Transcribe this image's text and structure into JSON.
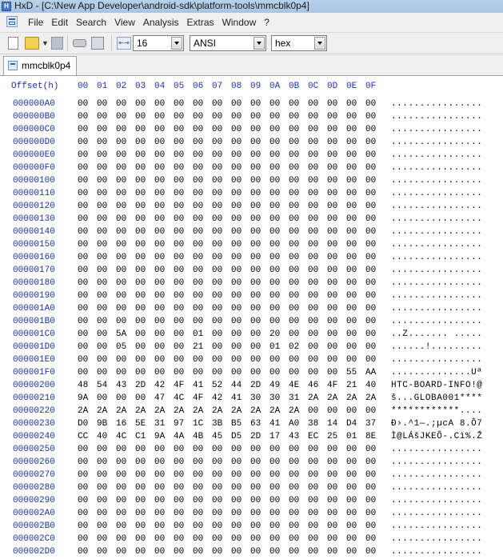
{
  "window": {
    "title": "HxD - [C:\\New App Developer\\android-sdk\\platform-tools\\mmcblk0p4]"
  },
  "menu": [
    "File",
    "Edit",
    "Search",
    "View",
    "Analysis",
    "Extras",
    "Window",
    "?"
  ],
  "toolbar": {
    "bytes_per_row": "16",
    "charset": "ANSI",
    "offset_base": "hex",
    "icons": [
      "new-file-icon",
      "open-file-icon",
      "save-icon",
      "open-disk-icon",
      "open-ram-icon",
      "bytes-per-row-icon"
    ]
  },
  "tabs": [
    {
      "label": "mmcblk0p4"
    }
  ],
  "hex": {
    "offset_header": "Offset(h)",
    "columns": [
      "00",
      "01",
      "02",
      "03",
      "04",
      "05",
      "06",
      "07",
      "08",
      "09",
      "0A",
      "0B",
      "0C",
      "0D",
      "0E",
      "0F"
    ],
    "rows": [
      {
        "offset": "000000A0",
        "bytes": [
          "00",
          "00",
          "00",
          "00",
          "00",
          "00",
          "00",
          "00",
          "00",
          "00",
          "00",
          "00",
          "00",
          "00",
          "00",
          "00"
        ],
        "ascii": "................"
      },
      {
        "offset": "000000B0",
        "bytes": [
          "00",
          "00",
          "00",
          "00",
          "00",
          "00",
          "00",
          "00",
          "00",
          "00",
          "00",
          "00",
          "00",
          "00",
          "00",
          "00"
        ],
        "ascii": "................"
      },
      {
        "offset": "000000C0",
        "bytes": [
          "00",
          "00",
          "00",
          "00",
          "00",
          "00",
          "00",
          "00",
          "00",
          "00",
          "00",
          "00",
          "00",
          "00",
          "00",
          "00"
        ],
        "ascii": "................"
      },
      {
        "offset": "000000D0",
        "bytes": [
          "00",
          "00",
          "00",
          "00",
          "00",
          "00",
          "00",
          "00",
          "00",
          "00",
          "00",
          "00",
          "00",
          "00",
          "00",
          "00"
        ],
        "ascii": "................"
      },
      {
        "offset": "000000E0",
        "bytes": [
          "00",
          "00",
          "00",
          "00",
          "00",
          "00",
          "00",
          "00",
          "00",
          "00",
          "00",
          "00",
          "00",
          "00",
          "00",
          "00"
        ],
        "ascii": "................"
      },
      {
        "offset": "000000F0",
        "bytes": [
          "00",
          "00",
          "00",
          "00",
          "00",
          "00",
          "00",
          "00",
          "00",
          "00",
          "00",
          "00",
          "00",
          "00",
          "00",
          "00"
        ],
        "ascii": "................"
      },
      {
        "offset": "00000100",
        "bytes": [
          "00",
          "00",
          "00",
          "00",
          "00",
          "00",
          "00",
          "00",
          "00",
          "00",
          "00",
          "00",
          "00",
          "00",
          "00",
          "00"
        ],
        "ascii": "................"
      },
      {
        "offset": "00000110",
        "bytes": [
          "00",
          "00",
          "00",
          "00",
          "00",
          "00",
          "00",
          "00",
          "00",
          "00",
          "00",
          "00",
          "00",
          "00",
          "00",
          "00"
        ],
        "ascii": "................"
      },
      {
        "offset": "00000120",
        "bytes": [
          "00",
          "00",
          "00",
          "00",
          "00",
          "00",
          "00",
          "00",
          "00",
          "00",
          "00",
          "00",
          "00",
          "00",
          "00",
          "00"
        ],
        "ascii": "................"
      },
      {
        "offset": "00000130",
        "bytes": [
          "00",
          "00",
          "00",
          "00",
          "00",
          "00",
          "00",
          "00",
          "00",
          "00",
          "00",
          "00",
          "00",
          "00",
          "00",
          "00"
        ],
        "ascii": "................"
      },
      {
        "offset": "00000140",
        "bytes": [
          "00",
          "00",
          "00",
          "00",
          "00",
          "00",
          "00",
          "00",
          "00",
          "00",
          "00",
          "00",
          "00",
          "00",
          "00",
          "00"
        ],
        "ascii": "................"
      },
      {
        "offset": "00000150",
        "bytes": [
          "00",
          "00",
          "00",
          "00",
          "00",
          "00",
          "00",
          "00",
          "00",
          "00",
          "00",
          "00",
          "00",
          "00",
          "00",
          "00"
        ],
        "ascii": "................"
      },
      {
        "offset": "00000160",
        "bytes": [
          "00",
          "00",
          "00",
          "00",
          "00",
          "00",
          "00",
          "00",
          "00",
          "00",
          "00",
          "00",
          "00",
          "00",
          "00",
          "00"
        ],
        "ascii": "................"
      },
      {
        "offset": "00000170",
        "bytes": [
          "00",
          "00",
          "00",
          "00",
          "00",
          "00",
          "00",
          "00",
          "00",
          "00",
          "00",
          "00",
          "00",
          "00",
          "00",
          "00"
        ],
        "ascii": "................"
      },
      {
        "offset": "00000180",
        "bytes": [
          "00",
          "00",
          "00",
          "00",
          "00",
          "00",
          "00",
          "00",
          "00",
          "00",
          "00",
          "00",
          "00",
          "00",
          "00",
          "00"
        ],
        "ascii": "................"
      },
      {
        "offset": "00000190",
        "bytes": [
          "00",
          "00",
          "00",
          "00",
          "00",
          "00",
          "00",
          "00",
          "00",
          "00",
          "00",
          "00",
          "00",
          "00",
          "00",
          "00"
        ],
        "ascii": "................"
      },
      {
        "offset": "000001A0",
        "bytes": [
          "00",
          "00",
          "00",
          "00",
          "00",
          "00",
          "00",
          "00",
          "00",
          "00",
          "00",
          "00",
          "00",
          "00",
          "00",
          "00"
        ],
        "ascii": "................"
      },
      {
        "offset": "000001B0",
        "bytes": [
          "00",
          "00",
          "00",
          "00",
          "00",
          "00",
          "00",
          "00",
          "00",
          "00",
          "00",
          "00",
          "00",
          "00",
          "00",
          "00"
        ],
        "ascii": "................"
      },
      {
        "offset": "000001C0",
        "bytes": [
          "00",
          "00",
          "5A",
          "00",
          "00",
          "00",
          "01",
          "00",
          "00",
          "00",
          "20",
          "00",
          "00",
          "00",
          "00",
          "00"
        ],
        "ascii": "..Z....... ....."
      },
      {
        "offset": "000001D0",
        "bytes": [
          "00",
          "00",
          "05",
          "00",
          "00",
          "00",
          "21",
          "00",
          "00",
          "00",
          "01",
          "02",
          "00",
          "00",
          "00",
          "00"
        ],
        "ascii": "......!........."
      },
      {
        "offset": "000001E0",
        "bytes": [
          "00",
          "00",
          "00",
          "00",
          "00",
          "00",
          "00",
          "00",
          "00",
          "00",
          "00",
          "00",
          "00",
          "00",
          "00",
          "00"
        ],
        "ascii": "................"
      },
      {
        "offset": "000001F0",
        "bytes": [
          "00",
          "00",
          "00",
          "00",
          "00",
          "00",
          "00",
          "00",
          "00",
          "00",
          "00",
          "00",
          "00",
          "00",
          "55",
          "AA"
        ],
        "ascii": "..............Uª"
      },
      {
        "offset": "00000200",
        "bytes": [
          "48",
          "54",
          "43",
          "2D",
          "42",
          "4F",
          "41",
          "52",
          "44",
          "2D",
          "49",
          "4E",
          "46",
          "4F",
          "21",
          "40"
        ],
        "ascii": "HTC-BOARD-INFO!@"
      },
      {
        "offset": "00000210",
        "bytes": [
          "9A",
          "00",
          "00",
          "00",
          "47",
          "4C",
          "4F",
          "42",
          "41",
          "30",
          "30",
          "31",
          "2A",
          "2A",
          "2A",
          "2A"
        ],
        "ascii": "š...GLOBA001****"
      },
      {
        "offset": "00000220",
        "bytes": [
          "2A",
          "2A",
          "2A",
          "2A",
          "2A",
          "2A",
          "2A",
          "2A",
          "2A",
          "2A",
          "2A",
          "2A",
          "00",
          "00",
          "00",
          "00"
        ],
        "ascii": "************...."
      },
      {
        "offset": "00000230",
        "bytes": [
          "D0",
          "9B",
          "16",
          "5E",
          "31",
          "97",
          "1C",
          "3B",
          "B5",
          "63",
          "41",
          "A0",
          "38",
          "14",
          "D4",
          "37"
        ],
        "ascii": "Ð›.^1—.;µcA 8.Ô7"
      },
      {
        "offset": "00000240",
        "bytes": [
          "CC",
          "40",
          "4C",
          "C1",
          "9A",
          "4A",
          "4B",
          "45",
          "D5",
          "2D",
          "17",
          "43",
          "EC",
          "25",
          "01",
          "8E"
        ],
        "ascii": "Ì@LÁšJKEÕ-.Cì%.Ž"
      },
      {
        "offset": "00000250",
        "bytes": [
          "00",
          "00",
          "00",
          "00",
          "00",
          "00",
          "00",
          "00",
          "00",
          "00",
          "00",
          "00",
          "00",
          "00",
          "00",
          "00"
        ],
        "ascii": "................"
      },
      {
        "offset": "00000260",
        "bytes": [
          "00",
          "00",
          "00",
          "00",
          "00",
          "00",
          "00",
          "00",
          "00",
          "00",
          "00",
          "00",
          "00",
          "00",
          "00",
          "00"
        ],
        "ascii": "................"
      },
      {
        "offset": "00000270",
        "bytes": [
          "00",
          "00",
          "00",
          "00",
          "00",
          "00",
          "00",
          "00",
          "00",
          "00",
          "00",
          "00",
          "00",
          "00",
          "00",
          "00"
        ],
        "ascii": "................"
      },
      {
        "offset": "00000280",
        "bytes": [
          "00",
          "00",
          "00",
          "00",
          "00",
          "00",
          "00",
          "00",
          "00",
          "00",
          "00",
          "00",
          "00",
          "00",
          "00",
          "00"
        ],
        "ascii": "................"
      },
      {
        "offset": "00000290",
        "bytes": [
          "00",
          "00",
          "00",
          "00",
          "00",
          "00",
          "00",
          "00",
          "00",
          "00",
          "00",
          "00",
          "00",
          "00",
          "00",
          "00"
        ],
        "ascii": "................"
      },
      {
        "offset": "000002A0",
        "bytes": [
          "00",
          "00",
          "00",
          "00",
          "00",
          "00",
          "00",
          "00",
          "00",
          "00",
          "00",
          "00",
          "00",
          "00",
          "00",
          "00"
        ],
        "ascii": "................"
      },
      {
        "offset": "000002B0",
        "bytes": [
          "00",
          "00",
          "00",
          "00",
          "00",
          "00",
          "00",
          "00",
          "00",
          "00",
          "00",
          "00",
          "00",
          "00",
          "00",
          "00"
        ],
        "ascii": "................"
      },
      {
        "offset": "000002C0",
        "bytes": [
          "00",
          "00",
          "00",
          "00",
          "00",
          "00",
          "00",
          "00",
          "00",
          "00",
          "00",
          "00",
          "00",
          "00",
          "00",
          "00"
        ],
        "ascii": "................"
      },
      {
        "offset": "000002D0",
        "bytes": [
          "00",
          "00",
          "00",
          "00",
          "00",
          "00",
          "00",
          "00",
          "00",
          "00",
          "00",
          "00",
          "00",
          "00",
          "00",
          "00"
        ],
        "ascii": "................"
      }
    ]
  }
}
